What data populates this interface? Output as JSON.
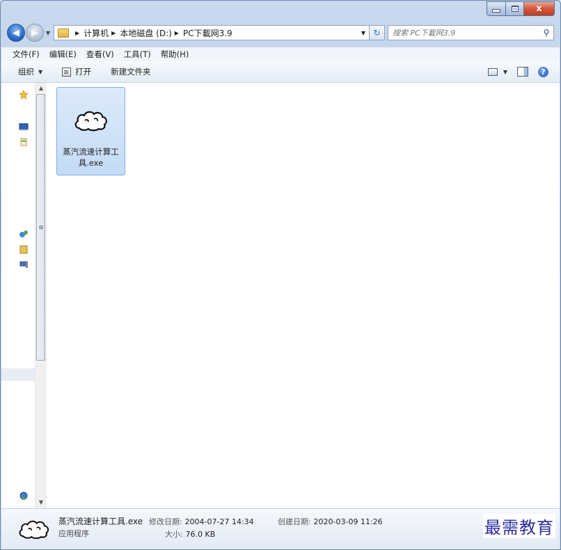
{
  "window": {
    "caption_close": "x"
  },
  "address_bar": {
    "crumbs": [
      "计算机",
      "本地磁盘 (D:)",
      "PC下載网3.9"
    ]
  },
  "search": {
    "placeholder": "搜索 PC下載网3.9"
  },
  "menu": [
    "文件(F)",
    "编辑(E)",
    "查看(V)",
    "工具(T)",
    "帮助(H)"
  ],
  "command_bar": {
    "organize": "组织",
    "open": "打开",
    "new_folder": "新建文件夹"
  },
  "files": [
    {
      "name": "蒸汽流速计算工具.exe",
      "icon": "cloud-app-icon",
      "selected": true
    }
  ],
  "details": {
    "name": "蒸汽流速计算工具.exe",
    "type": "应用程序",
    "modified_label": "修改日期:",
    "modified_value": "2004-07-27 14:34",
    "size_label": "大小:",
    "size_value": "76.0 KB",
    "created_label": "创建日期:",
    "created_value": "2020-03-09 11:26"
  },
  "watermark": "最需教育"
}
